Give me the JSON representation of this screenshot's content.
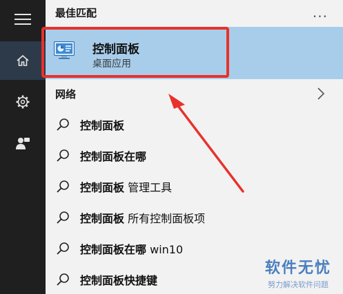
{
  "section": {
    "best_match_title": "最佳匹配",
    "more_label": "..."
  },
  "best_match": {
    "name": "控制面板",
    "subtitle": "桌面应用",
    "icon": "control-panel-icon"
  },
  "network": {
    "label": "网络"
  },
  "suggestions": [
    {
      "bold": "控制面板",
      "rest": ""
    },
    {
      "bold": "控制面板在哪",
      "rest": ""
    },
    {
      "bold": "控制面板",
      "rest": " 管理工具"
    },
    {
      "bold": "控制面板",
      "rest": " 所有控制面板项"
    },
    {
      "bold": "控制面板在哪",
      "rest": " win10"
    },
    {
      "bold": "控制面板快捷键",
      "rest": ""
    }
  ],
  "sidebar": {
    "items": [
      {
        "icon": "hamburger-menu-icon"
      },
      {
        "icon": "home-icon"
      },
      {
        "icon": "gear-icon"
      },
      {
        "icon": "user-feedback-icon"
      }
    ]
  },
  "watermark": {
    "main": "软件无忧",
    "sub": "努力解决软件问题"
  },
  "colors": {
    "highlight": "#a8cdeb",
    "annotation": "#e8312b",
    "sidebar": "#1f1f1f"
  }
}
